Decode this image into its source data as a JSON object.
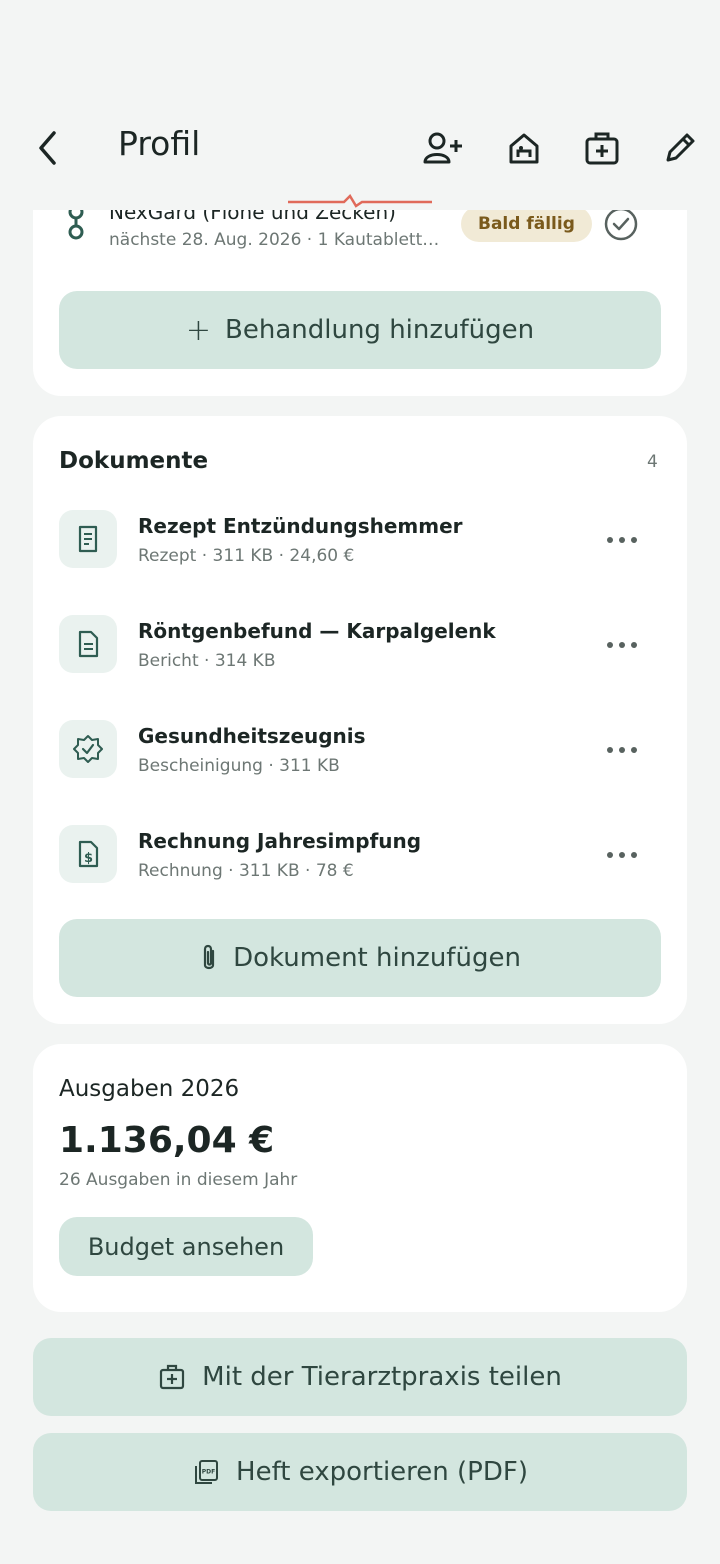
{
  "header": {
    "title": "Profil",
    "icons": [
      "back-arrow-icon",
      "add-person-icon",
      "pet-house-icon",
      "vet-kit-icon",
      "edit-pencil-icon"
    ]
  },
  "treatment": {
    "name": "NexGard (Flöhe und Zecken)",
    "detail": "nächste 28. Aug. 2026 · 1 Kautablett…",
    "badge": "Bald fällig",
    "add_label": "Behandlung hinzufügen"
  },
  "documents": {
    "title": "Dokumente",
    "count": "4",
    "items": [
      {
        "title": "Rezept Entzündungshemmer",
        "sub": "Rezept · 311 KB · 24,60 €",
        "icon": "receipt-icon"
      },
      {
        "title": "Röntgenbefund — Karpalgelenk",
        "sub": "Bericht · 314 KB",
        "icon": "document-icon"
      },
      {
        "title": "Gesundheitszeugnis",
        "sub": "Bescheinigung · 311 KB",
        "icon": "certificate-badge-icon"
      },
      {
        "title": "Rechnung Jahresimpfung",
        "sub": "Rechnung · 311 KB · 78 €",
        "icon": "invoice-dollar-icon"
      }
    ],
    "add_label": "Dokument hinzufügen"
  },
  "expenses": {
    "title": "Ausgaben 2026",
    "amount": "1.136,04 €",
    "caption": "26 Ausgaben in diesem Jahr",
    "button": "Budget ansehen"
  },
  "actions": {
    "share": "Mit der Tierarztpraxis teilen",
    "export": "Heft exportieren (PDF)"
  },
  "colors": {
    "accent_bg": "#d3e6df",
    "accent_text": "#2f4740",
    "badge_bg": "#f1ead6",
    "badge_text": "#7a5a1c",
    "scroll_indicator": "#e06a5a"
  }
}
